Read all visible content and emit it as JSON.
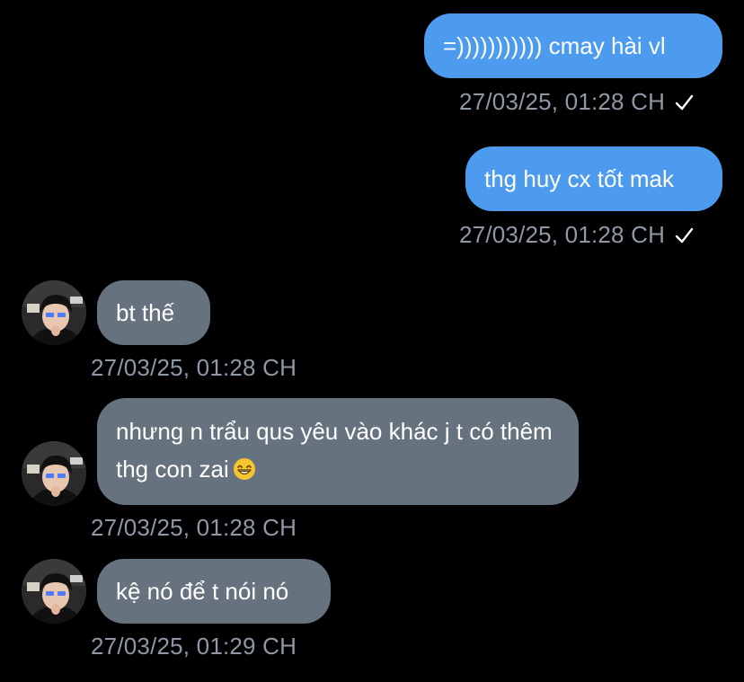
{
  "chat": {
    "messages": [
      {
        "direction": "outgoing",
        "text": "=))))))))))) cmay hài vl",
        "time": "27/03/25, 01:28 CH",
        "status_icon": "check-icon"
      },
      {
        "direction": "outgoing",
        "text": "thg huy cx tốt mak",
        "time": "27/03/25, 01:28 CH",
        "status_icon": "check-icon"
      },
      {
        "direction": "incoming",
        "text": "bt thế",
        "time": "27/03/25, 01:28 CH"
      },
      {
        "direction": "incoming",
        "text": "nhưng n trẩu qus yêu vào khác j t có thêm thg con zai",
        "emoji": "grinning-face-emoji",
        "time": "27/03/25, 01:28 CH"
      },
      {
        "direction": "incoming",
        "text": "kệ nó để t nói nó",
        "time": "27/03/25, 01:29 CH"
      }
    ]
  },
  "colors": {
    "background": "#000000",
    "outgoing_bubble": "#4c9bee",
    "incoming_bubble": "#67727f",
    "timestamp": "#8f98a5"
  }
}
